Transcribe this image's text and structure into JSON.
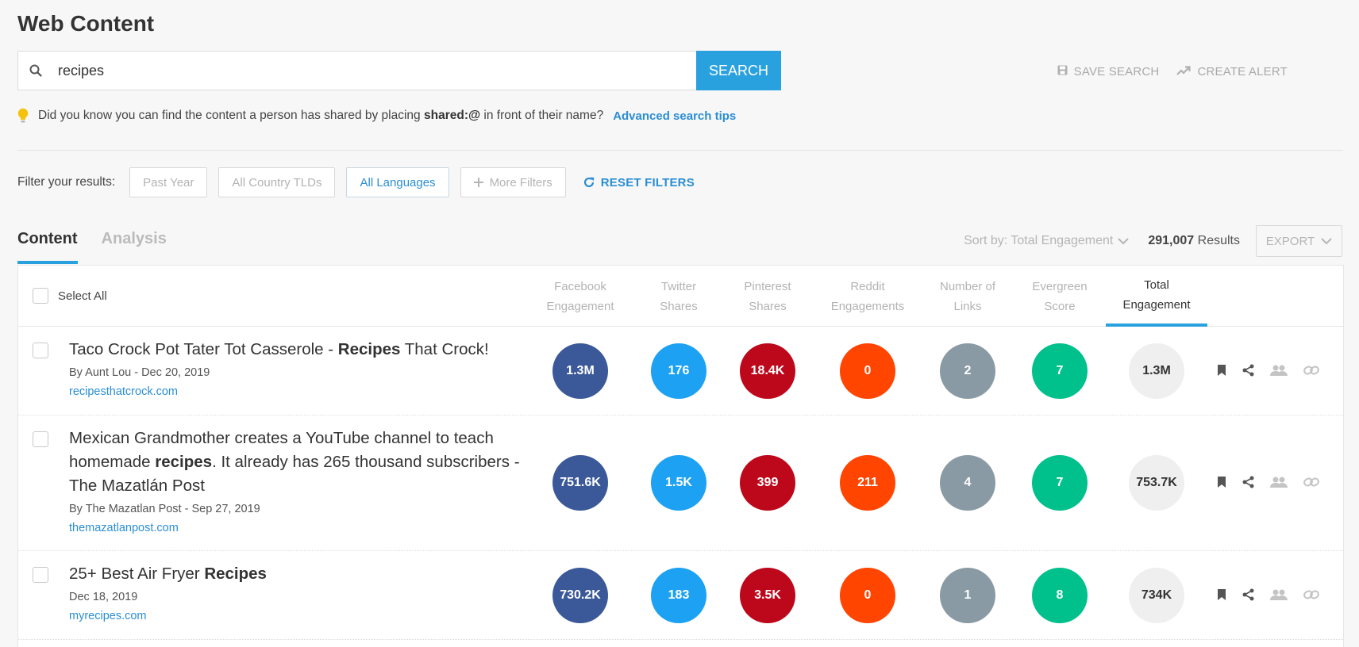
{
  "page": {
    "title": "Web Content"
  },
  "search": {
    "value": "recipes",
    "button_label": "SEARCH"
  },
  "actions": {
    "save_search": "SAVE SEARCH",
    "create_alert": "CREATE ALERT"
  },
  "tip": {
    "text_before": "Did you know you can find the content a person has shared by placing",
    "strong": "shared:@",
    "text_after": "in front of their name?",
    "link": "Advanced search tips"
  },
  "filters": {
    "label": "Filter your results:",
    "past_year": "Past Year",
    "country": "All Country TLDs",
    "languages": "All Languages",
    "more": "More Filters",
    "reset": "RESET FILTERS"
  },
  "tabs": {
    "content": "Content",
    "analysis": "Analysis"
  },
  "sort": {
    "label": "Sort by: Total Engagement",
    "results_count": "291,007",
    "results_label": "Results",
    "export": "EXPORT"
  },
  "table": {
    "select_all": "Select All",
    "columns": {
      "facebook": {
        "l1": "Facebook",
        "l2": "Engagement"
      },
      "twitter": {
        "l1": "Twitter",
        "l2": "Shares"
      },
      "pinterest": {
        "l1": "Pinterest",
        "l2": "Shares"
      },
      "reddit": {
        "l1": "Reddit",
        "l2": "Engagements"
      },
      "links": {
        "l1": "Number of",
        "l2": "Links"
      },
      "evergreen": {
        "l1": "Evergreen",
        "l2": "Score"
      },
      "total": {
        "l1": "Total",
        "l2": "Engagement"
      }
    },
    "rows": [
      {
        "title_pre": "Taco Crock Pot Tater Tot Casserole - ",
        "title_bold": "Recipes",
        "title_post": " That Crock!",
        "meta": "By Aunt Lou - Dec 20, 2019",
        "domain": "recipesthatcrock.com",
        "facebook": "1.3M",
        "twitter": "176",
        "pinterest": "18.4K",
        "reddit": "0",
        "links": "2",
        "evergreen": "7",
        "total": "1.3M"
      },
      {
        "title_pre": "Mexican Grandmother creates a YouTube channel to teach homemade ",
        "title_bold": "recipes",
        "title_post": ". It already has 265 thousand subscribers - The Mazatlán Post",
        "meta": "By The Mazatlan Post - Sep 27, 2019",
        "domain": "themazatlanpost.com",
        "facebook": "751.6K",
        "twitter": "1.5K",
        "pinterest": "399",
        "reddit": "211",
        "links": "4",
        "evergreen": "7",
        "total": "753.7K"
      },
      {
        "title_pre": "25+ Best Air Fryer ",
        "title_bold": "Recipes",
        "title_post": "",
        "meta": "Dec 18, 2019",
        "domain": "myrecipes.com",
        "facebook": "730.2K",
        "twitter": "183",
        "pinterest": "3.5K",
        "reddit": "0",
        "links": "1",
        "evergreen": "8",
        "total": "734K"
      }
    ]
  },
  "colors": {
    "facebook": "#3b5998",
    "twitter": "#1da1f2",
    "pinterest": "#bd081c",
    "reddit": "#ff4500",
    "links": "#8a9aa4",
    "evergreen": "#00c08b",
    "accent": "#2aa1df"
  }
}
